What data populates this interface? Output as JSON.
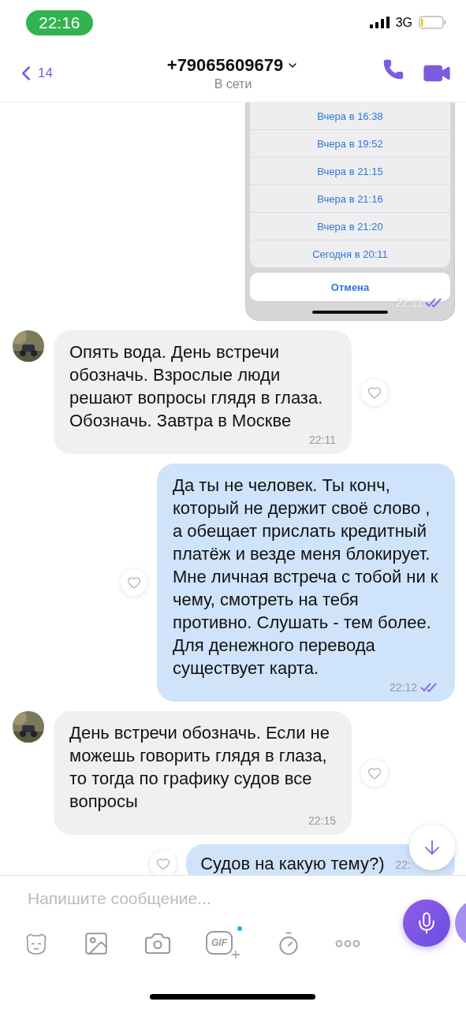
{
  "status_bar": {
    "time": "22:16",
    "network": "3G"
  },
  "header": {
    "back_count": "14",
    "title": "+79065609679",
    "subtitle": "В сети"
  },
  "messages": [
    {
      "kind": "screenshot",
      "outgoing": true,
      "rows": [
        "Вчера в 16:38",
        "Вчера в 19:52",
        "Вчера в 21:15",
        "Вчера в 21:16",
        "Вчера в 21:20",
        "Сегодня в 20:11"
      ],
      "cancel": "Отмена",
      "time": "22:11",
      "read": true
    },
    {
      "kind": "text",
      "outgoing": false,
      "text": "Опять вода. День встречи обозначь. Взрослые люди решают вопросы глядя в глаза. Обозначь. Завтра в Москве",
      "time": "22:11"
    },
    {
      "kind": "text",
      "outgoing": true,
      "text": "Да ты не человек. Ты конч, который не держит своё слово , а обещает прислать кредитный платёж и везде меня блокирует. Мне личная встреча с тобой ни к чему, смотреть на тебя противно. Слушать - тем более. Для денежного перевода существует карта.",
      "time": "22:12",
      "read": true
    },
    {
      "kind": "text",
      "outgoing": false,
      "text": "День встречи обозначь. Если не можешь говорить глядя в глаза, то тогда по графику судов все вопросы",
      "time": "22:15"
    },
    {
      "kind": "text",
      "outgoing": true,
      "text": "Судов на какую тему?)",
      "time": "22:"
    }
  ],
  "composer": {
    "placeholder": "Напишите сообщение...",
    "gif_label": "GIF"
  }
}
